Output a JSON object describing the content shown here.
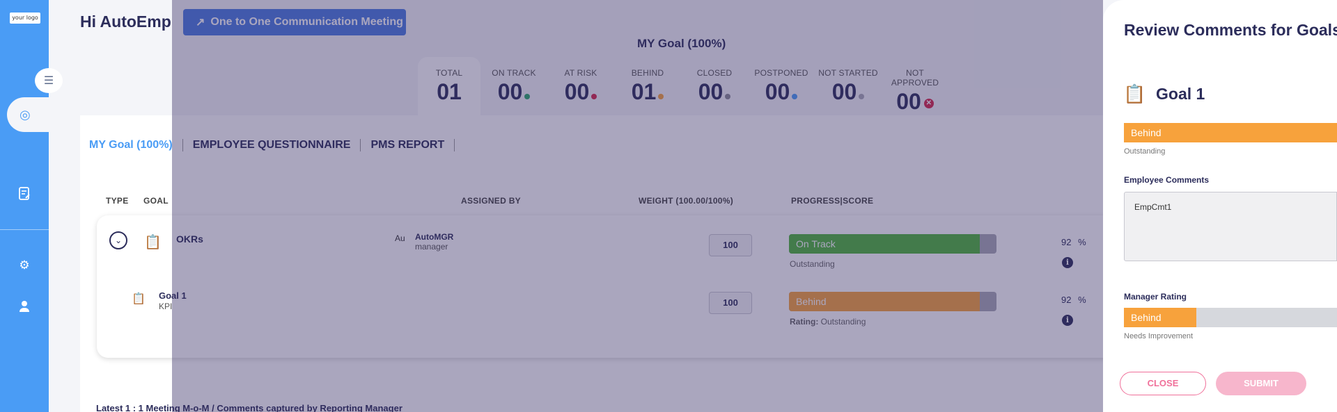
{
  "sidebar": {
    "logo_text": "your logo",
    "collapse_icon": "menu-collapse-icon",
    "active_icon": "target-icon",
    "items": [
      {
        "icon": "document-edit-icon"
      },
      {
        "icon": "gear-icon"
      },
      {
        "icon": "user-icon"
      }
    ]
  },
  "header": {
    "greeting": "Hi AutoEmp",
    "meeting_button": "One to One Communication Meeting",
    "goal_title": "MY Goal (100%)"
  },
  "stats": [
    {
      "label": "TOTAL",
      "value": "01",
      "dot_color": ""
    },
    {
      "label": "ON TRACK",
      "value": "00",
      "dot_color": "#2ea86b"
    },
    {
      "label": "AT RISK",
      "value": "00",
      "dot_color": "#d6294a"
    },
    {
      "label": "BEHIND",
      "value": "01",
      "dot_color": "#f7a23c"
    },
    {
      "label": "CLOSED",
      "value": "00",
      "dot_color": "#8a8a95"
    },
    {
      "label": "POSTPONED",
      "value": "00",
      "dot_color": "#4a9cf5"
    },
    {
      "label": "NOT STARTED",
      "value": "00",
      "dot_color": "#aaaab5"
    },
    {
      "label": "NOT APPROVED",
      "value": "00",
      "dot_color": "x"
    }
  ],
  "tabs": [
    "MY Goal (100%)",
    "EMPLOYEE QUESTIONNAIRE",
    "PMS REPORT"
  ],
  "table": {
    "headers": {
      "type": "TYPE",
      "goal": "GOAL",
      "assigned_by": "ASSIGNED BY",
      "weight": "WEIGHT (100.00/100%)",
      "progress": "PROGRESS|SCORE"
    },
    "parent": {
      "name": "OKRs",
      "avatar_alt": "Au",
      "assigner_name": "AutoMGR",
      "assigner_role": "manager",
      "weight": "100",
      "status": "On Track",
      "status_color": "#4fb53a",
      "progress": 0.92,
      "sub": "Outstanding",
      "percent": "92 %"
    },
    "child": {
      "name": "Goal 1",
      "type": "KPI",
      "weight": "100",
      "status": "Behind",
      "status_color": "#f7a23c",
      "progress": 0.92,
      "rating_label": "Rating:",
      "rating_value": "Outstanding",
      "percent": "92 %"
    }
  },
  "footer_text": "Latest 1 : 1 Meeting M-o-M / Comments captured by Reporting Manager",
  "drawer": {
    "title": "Review Comments for Goals",
    "goal_name": "Goal 1",
    "status": "Behind",
    "status_sub": "Outstanding",
    "employee_comments_label": "Employee Comments",
    "employee_comments": "EmpCmt1",
    "manager_rating_label": "Manager Rating",
    "manager_rating": "Behind",
    "manager_rating_fraction": 0.34,
    "manager_rating_sub": "Needs Improvement",
    "close_label": "CLOSE",
    "submit_label": "SUBMIT"
  }
}
